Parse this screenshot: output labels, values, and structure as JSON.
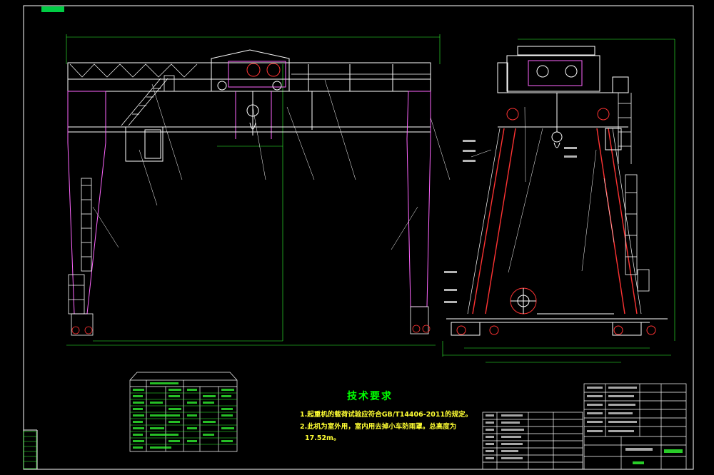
{
  "sheet": {
    "frame_tag": "",
    "background": "#000000",
    "colors": {
      "structure": "#ffffff",
      "outline": "#ff66ff",
      "dimension": "#33ff33",
      "accent": "#ff3333",
      "text": "#ffff33",
      "cyan": "#33ffff"
    }
  },
  "technical_requirements": {
    "title": "技术要求",
    "line1": "1.起重机的载荷试验应符合GB/T14406-2011的规定。",
    "line2": "2.此机为室外用，室内用去掉小车防雨罩。总高度为",
    "line3": "17.52m。"
  }
}
